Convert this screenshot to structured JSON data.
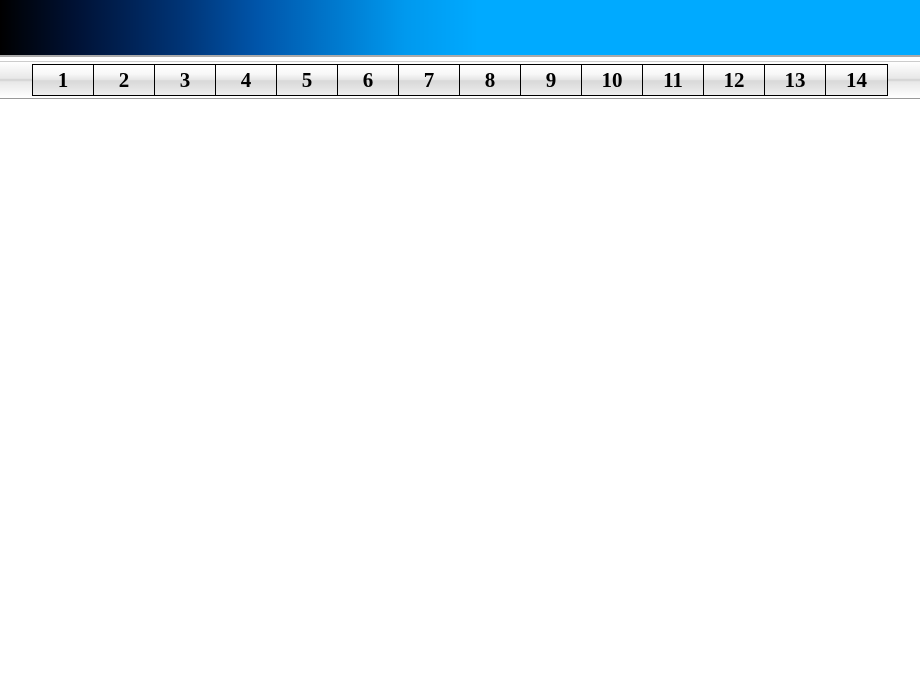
{
  "nav": {
    "buttons": [
      {
        "label": "1"
      },
      {
        "label": "2"
      },
      {
        "label": "3"
      },
      {
        "label": "4"
      },
      {
        "label": "5"
      },
      {
        "label": "6"
      },
      {
        "label": "7"
      },
      {
        "label": "8"
      },
      {
        "label": "9"
      },
      {
        "label": "10"
      },
      {
        "label": "11"
      },
      {
        "label": "12"
      },
      {
        "label": "13"
      },
      {
        "label": "14"
      }
    ]
  }
}
